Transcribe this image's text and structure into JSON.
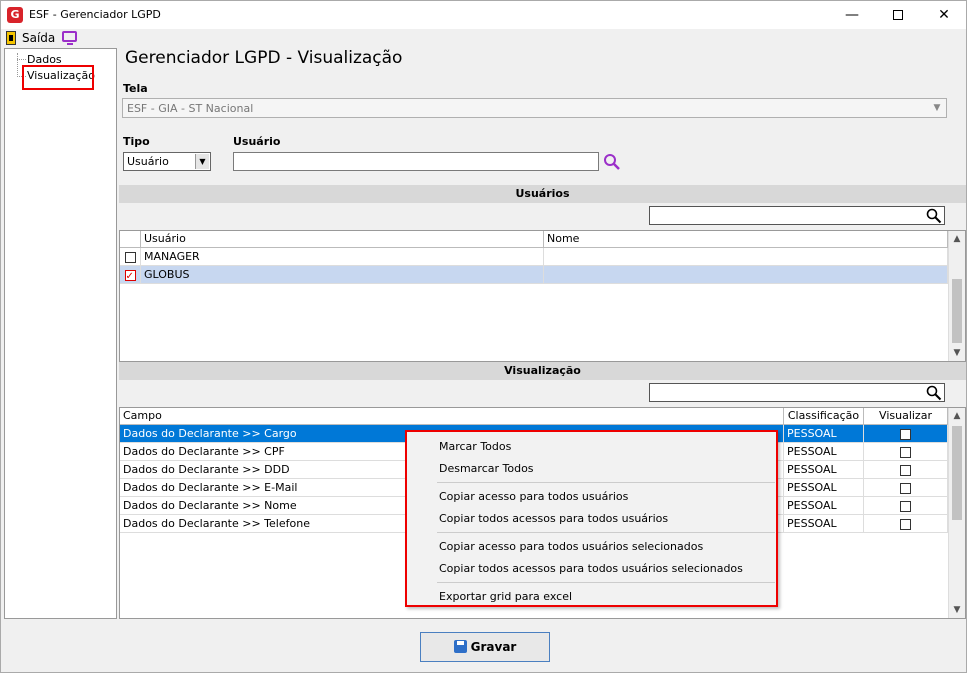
{
  "window": {
    "title": "ESF - Gerenciador LGPD",
    "logo_letter": "G"
  },
  "toolbar": {
    "exit_label": "Saída"
  },
  "sidebar": {
    "items": [
      {
        "label": "Dados"
      },
      {
        "label": "Visualização"
      }
    ]
  },
  "main": {
    "title": "Gerenciador LGPD - Visualização",
    "tela_label": "Tela",
    "tela_value": "ESF - GIA - ST Nacional",
    "tipo_label": "Tipo",
    "tipo_value": "Usuário",
    "usuario_label": "Usuário",
    "usuario_value": ""
  },
  "usuarios": {
    "header": "Usuários",
    "columns": [
      "Usuário",
      "Nome"
    ],
    "rows": [
      {
        "usuario": "MANAGER",
        "nome": "",
        "checked": false
      },
      {
        "usuario": "GLOBUS",
        "nome": "",
        "checked": true
      }
    ]
  },
  "visualizacao": {
    "header": "Visualização",
    "columns": [
      "Campo",
      "Classificação",
      "Visualizar"
    ],
    "rows": [
      {
        "campo": "Dados do Declarante >> Cargo",
        "classificacao": "PESSOAL",
        "visualizar": false
      },
      {
        "campo": "Dados do Declarante >> CPF",
        "classificacao": "PESSOAL",
        "visualizar": false
      },
      {
        "campo": "Dados do Declarante >> DDD",
        "classificacao": "PESSOAL",
        "visualizar": false
      },
      {
        "campo": "Dados do Declarante >> E-Mail",
        "classificacao": "PESSOAL",
        "visualizar": false
      },
      {
        "campo": "Dados do Declarante >> Nome",
        "classificacao": "PESSOAL",
        "visualizar": false
      },
      {
        "campo": "Dados do Declarante >> Telefone",
        "classificacao": "PESSOAL",
        "visualizar": false
      }
    ]
  },
  "context_menu": {
    "items": [
      "Marcar Todos",
      "Desmarcar Todos",
      "Copiar acesso para todos usuários",
      "Copiar todos acessos para todos usuários",
      "Copiar acesso para todos usuários selecionados",
      "Copiar todos acessos para todos usuários selecionados",
      "Exportar grid para excel"
    ]
  },
  "footer": {
    "save_label": "Gravar"
  },
  "colors": {
    "selection": "#0078d7",
    "row_highlight": "#c7d7f0",
    "accent_red": "#e00000",
    "search_purple": "#9b2fc9"
  },
  "icons": [
    "app-logo-icon",
    "exit-door-icon",
    "monitor-icon",
    "search-icon",
    "floppy-disk-icon"
  ]
}
